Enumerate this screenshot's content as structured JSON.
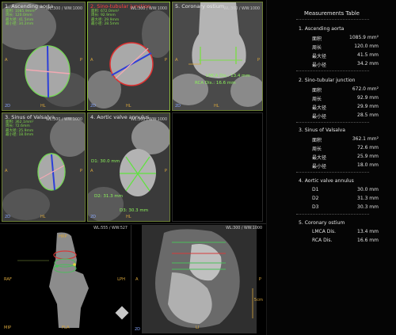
{
  "viewports": [
    {
      "title": "1. Ascending aorta",
      "lines": [
        "面积: 1085.9mm²",
        "周长: 120.0mm",
        "最大径: 41.5mm",
        "最小径: 34.2mm"
      ],
      "wl": "WL:300 / WW:1000",
      "ori_l": "A",
      "ori_r": "P",
      "ori_b": "HL",
      "two": "2D"
    },
    {
      "title": "2. Sino-tubular junction",
      "lines": [
        "面积: 672.0mm²",
        "周长: 92.9mm",
        "最大径: 29.9mm",
        "最小径: 28.5mm"
      ],
      "wl": "WL:300 / WW:1000",
      "ori_l": "A",
      "ori_r": "P",
      "ori_b": "HL",
      "two": "2D"
    },
    {
      "title": "5. Coronary ostium",
      "wl": "WL:300 / WW:1000",
      "ori_l": "A",
      "ori_r": "P",
      "ori_b": "HL",
      "two": "2D",
      "m1": "LMCA Dis.: 13.4 mm",
      "m2": "RCA Dis.: 16.6 mm"
    },
    {
      "title": "3. Sinus of Valsalva",
      "lines": [
        "面积: 362.1mm²",
        "周长: 72.6mm",
        "最大径: 25.9mm",
        "最小径: 18.0mm"
      ],
      "wl": "WL:300 / WW:1000",
      "ori_l": "A",
      "ori_r": "P",
      "ori_b": "HL",
      "two": "2D"
    },
    {
      "title": "4. Aortic valve annulus",
      "wl": "WL:300 / WW:1000",
      "ori_l": "A",
      "ori_r": "P",
      "ori_b": "HL",
      "two": "2D",
      "m1": "D1: 30.0 mm",
      "m2": "D2: 31.3 mm",
      "m3": "D3: 30.3 mm"
    }
  ],
  "bottom_left": {
    "wl": "WL:555 / WW:527",
    "top": "HRP",
    "left": "RAF",
    "right": "LPH",
    "bl": "MIP",
    "bottom": "FLA"
  },
  "bottom_right": {
    "wl": "WL:300 / WW:1000",
    "left": "A",
    "right": "P",
    "bottom": "LI",
    "two": "2D",
    "scale": "5cm"
  },
  "table": {
    "title": "Measurements Table",
    "sections": [
      {
        "title": "1. Ascending aorta",
        "rows": [
          [
            "面积",
            "1085.9 mm²"
          ],
          [
            "周长",
            "120.0 mm"
          ],
          [
            "最大径",
            "41.5 mm"
          ],
          [
            "最小径",
            "34.2 mm"
          ]
        ]
      },
      {
        "title": "2. Sino-tubular junction",
        "rows": [
          [
            "面积",
            "672.0 mm²"
          ],
          [
            "周长",
            "92.9 mm"
          ],
          [
            "最大径",
            "29.9 mm"
          ],
          [
            "最小径",
            "28.5 mm"
          ]
        ]
      },
      {
        "title": "3. Sinus of Valsalva",
        "rows": [
          [
            "面积",
            "362.1 mm²"
          ],
          [
            "周长",
            "72.6 mm"
          ],
          [
            "最大径",
            "25.9 mm"
          ],
          [
            "最小径",
            "18.0 mm"
          ]
        ]
      },
      {
        "title": "4. Aortic valve annulus",
        "rows": [
          [
            "D1",
            "30.0 mm"
          ],
          [
            "D2",
            "31.3 mm"
          ],
          [
            "D3",
            "30.3 mm"
          ]
        ]
      },
      {
        "title": "5. Coronary ostium",
        "rows": [
          [
            "LMCA Dis.",
            "13.4 mm"
          ],
          [
            "RCA Dis.",
            "16.6 mm"
          ]
        ]
      }
    ]
  }
}
